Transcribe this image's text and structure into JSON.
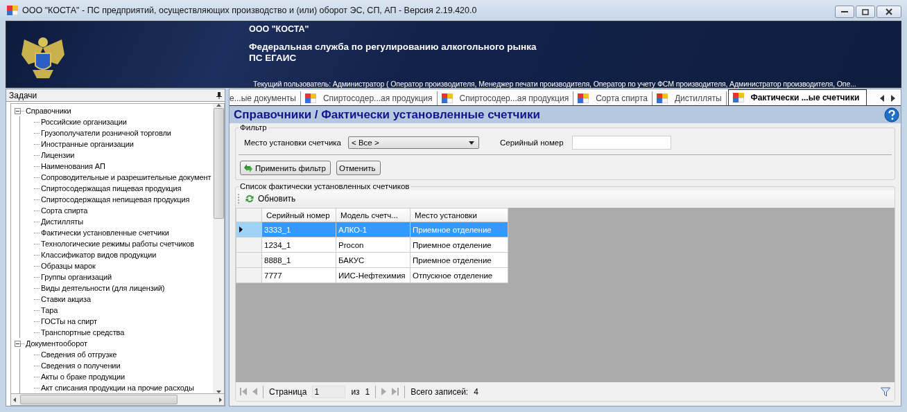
{
  "window": {
    "title": "ООО \"КОСТА\" - ПС предприятий, осуществляющих производство и (или) оборот ЭС, СП, АП - Версия 2.19.420.0"
  },
  "banner": {
    "company": "ООО \"КОСТА\"",
    "agency": "Федеральная служба по регулированию алкогольного рынка",
    "system": "ПС ЕГАИС",
    "user_line": "Текущий пользователь: Администратор ( Оператор производителя, Менеджер печати производителя, Оператор по учету ФСМ производителя, Администратор производителя, Опе..."
  },
  "tasks_panel": {
    "title": "Задачи",
    "tree": [
      {
        "label": "Справочники",
        "expanded": true,
        "children": [
          {
            "label": "Российские организации"
          },
          {
            "label": "Грузополучатели розничной торговли"
          },
          {
            "label": "Иностранные организации"
          },
          {
            "label": "Лицензии"
          },
          {
            "label": "Наименования АП"
          },
          {
            "label": "Сопроводительные и разрешительные документ"
          },
          {
            "label": "Спиртосодержащая пищевая продукция"
          },
          {
            "label": "Спиртосодержащая непищевая продукция"
          },
          {
            "label": "Сорта спирта"
          },
          {
            "label": "Дистилляты"
          },
          {
            "label": "Фактически установленные счетчики"
          },
          {
            "label": "Технологические режимы работы счетчиков"
          },
          {
            "label": "Классификатор видов продукции"
          },
          {
            "label": "Образцы марок"
          },
          {
            "label": "Группы организаций"
          },
          {
            "label": "Виды деятельности (для лицензий)"
          },
          {
            "label": "Ставки акциза"
          },
          {
            "label": "Тара"
          },
          {
            "label": "ГОСТы на спирт"
          },
          {
            "label": "Транспортные средства"
          }
        ]
      },
      {
        "label": "Документооборот",
        "expanded": true,
        "children": [
          {
            "label": "Сведения об отгрузке"
          },
          {
            "label": "Сведения о получении"
          },
          {
            "label": "Акты о браке продукции"
          },
          {
            "label": "Акт списания продукции на прочие расходы"
          }
        ]
      }
    ]
  },
  "tabs": [
    {
      "label": "е...ые документы",
      "selected": false
    },
    {
      "label": "Спиртосодер...ая продукция",
      "selected": false
    },
    {
      "label": "Спиртосодер...ая продукция",
      "selected": false
    },
    {
      "label": "Сорта спирта",
      "selected": false
    },
    {
      "label": "Дистилляты",
      "selected": false
    },
    {
      "label": "Фактически ...ые счетчики",
      "selected": true
    }
  ],
  "page_title": "Справочники / Фактически установленные счетчики",
  "filter": {
    "title": "Фильтр",
    "location_label": "Место установки счетчика",
    "location_value": "< Все >",
    "serial_label": "Серийный номер",
    "apply_button": "Применить фильтр",
    "cancel_button": "Отменить"
  },
  "list": {
    "title": "Список фактически установленных счетчиков",
    "refresh_button": "Обновить",
    "columns": [
      "Серийный номер",
      "Модель счетч...",
      "Место установки"
    ],
    "rows": [
      {
        "cells": [
          "3333_1",
          "АЛКО-1",
          "Приемное отделение"
        ],
        "selected": true
      },
      {
        "cells": [
          "1234_1",
          "Procon",
          "Приемное отделение"
        ],
        "selected": false
      },
      {
        "cells": [
          "8888_1",
          "БАКУС",
          "Приемное отделение"
        ],
        "selected": false
      },
      {
        "cells": [
          "7777",
          "ИИС-Нефтехимия",
          "Отпускное отделение"
        ],
        "selected": false
      }
    ]
  },
  "pager": {
    "page_label": "Страница",
    "page_value": "1",
    "of_label": "из",
    "total_pages": "1",
    "total_label": "Всего записей:",
    "total": "4"
  }
}
